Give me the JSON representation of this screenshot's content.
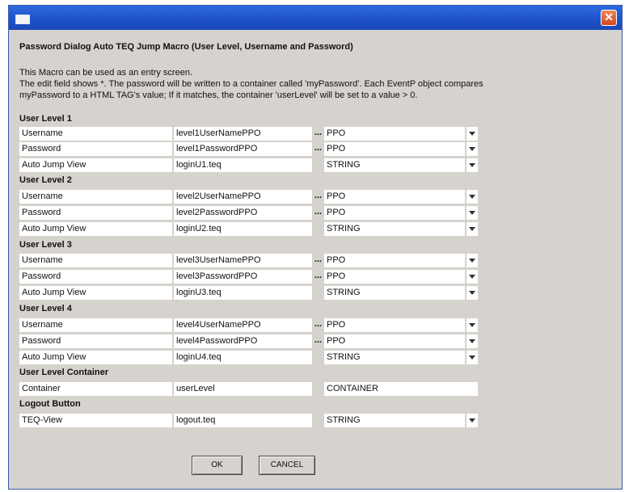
{
  "window": {
    "close_glyph": "✕"
  },
  "dialog_title": "Password Dialog Auto TEQ Jump Macro (User Level, Username and Password)",
  "description": [
    "This Macro can be used as an entry screen.",
    "The edit field shows *. The password will be written to a container called 'myPassword'. Each EventP object compares",
    "myPassword to a HTML TAG's value; If it matches, the container 'userLevel' will be set to a value > 0."
  ],
  "sections": [
    {
      "title": "User Level 1",
      "rows": [
        {
          "label": "Username",
          "value": "level1UserNamePPO",
          "dots": "...",
          "type": "PPO"
        },
        {
          "label": "Password",
          "value": "level1PasswordPPO",
          "dots": "...",
          "type": "PPO"
        },
        {
          "label": "Auto Jump View",
          "value": "loginU1.teq",
          "dots": "",
          "type": "STRING"
        }
      ]
    },
    {
      "title": "User Level 2",
      "rows": [
        {
          "label": "Username",
          "value": "level2UserNamePPO",
          "dots": "...",
          "type": "PPO"
        },
        {
          "label": "Password",
          "value": "level2PasswordPPO",
          "dots": "...",
          "type": "PPO"
        },
        {
          "label": "Auto Jump View",
          "value": "loginU2.teq",
          "dots": "",
          "type": "STRING"
        }
      ]
    },
    {
      "title": "User Level 3",
      "rows": [
        {
          "label": "Username",
          "value": "level3UserNamePPO",
          "dots": "...",
          "type": "PPO"
        },
        {
          "label": "Password",
          "value": "level3PasswordPPO",
          "dots": "...",
          "type": "PPO"
        },
        {
          "label": "Auto Jump View",
          "value": "loginU3.teq",
          "dots": "",
          "type": "STRING"
        }
      ]
    },
    {
      "title": "User Level 4",
      "rows": [
        {
          "label": "Username",
          "value": "level4UserNamePPO",
          "dots": "...",
          "type": "PPO"
        },
        {
          "label": "Password",
          "value": "level4PasswordPPO",
          "dots": "...",
          "type": "PPO"
        },
        {
          "label": "Auto Jump View",
          "value": "loginU4.teq",
          "dots": "",
          "type": "STRING"
        }
      ]
    },
    {
      "title": "User Level Container",
      "rows": [
        {
          "label": "Container",
          "value": "userLevel",
          "dots": "",
          "type": "CONTAINER"
        }
      ]
    },
    {
      "title": "Logout Button",
      "rows": [
        {
          "label": "TEQ-View",
          "value": "logout.teq",
          "dots": "",
          "type": "STRING"
        }
      ]
    }
  ],
  "buttons": {
    "ok": "OK",
    "cancel": "CANCEL"
  }
}
